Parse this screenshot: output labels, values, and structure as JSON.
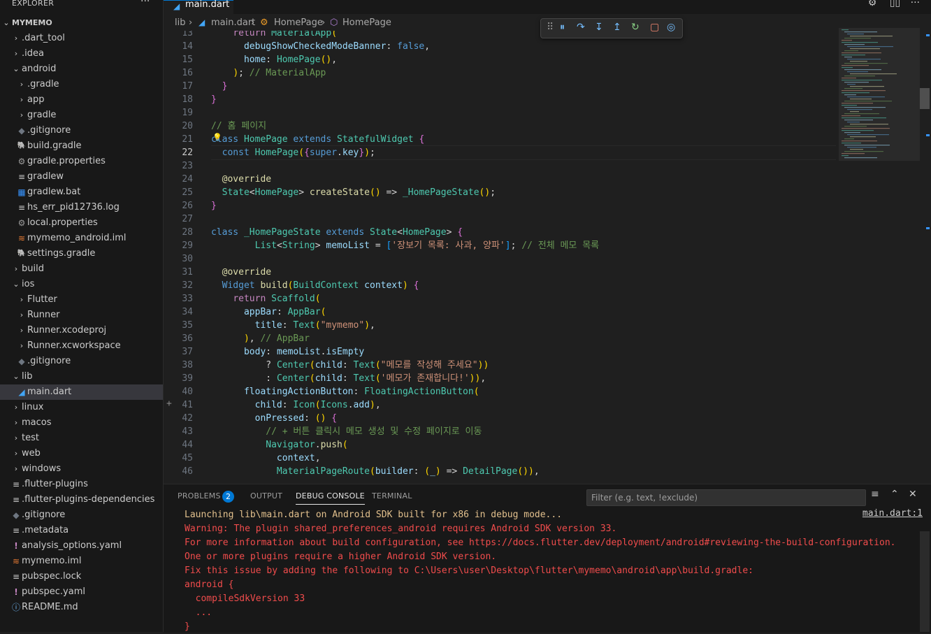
{
  "sidebar": {
    "explorer_title": "EXPLORER",
    "more_icon": "ellipsis-icon",
    "root": "MYMEMO",
    "items": [
      {
        "label": ".dart_tool",
        "kind": "folder",
        "depth": 1,
        "expanded": false
      },
      {
        "label": ".idea",
        "kind": "folder",
        "depth": 1,
        "expanded": false
      },
      {
        "label": "android",
        "kind": "folder",
        "depth": 1,
        "expanded": true
      },
      {
        "label": ".gradle",
        "kind": "folder",
        "depth": 2,
        "expanded": false
      },
      {
        "label": "app",
        "kind": "folder",
        "depth": 2,
        "expanded": false
      },
      {
        "label": "gradle",
        "kind": "folder",
        "depth": 2,
        "expanded": false
      },
      {
        "label": ".gitignore",
        "kind": "git",
        "depth": 2
      },
      {
        "label": "build.gradle",
        "kind": "gradle",
        "depth": 2
      },
      {
        "label": "gradle.properties",
        "kind": "gear",
        "depth": 2
      },
      {
        "label": "gradlew",
        "kind": "lines",
        "depth": 2
      },
      {
        "label": "gradlew.bat",
        "kind": "windows",
        "depth": 2
      },
      {
        "label": "hs_err_pid12736.log",
        "kind": "lines",
        "depth": 2
      },
      {
        "label": "local.properties",
        "kind": "gear",
        "depth": 2
      },
      {
        "label": "mymemo_android.iml",
        "kind": "rss",
        "depth": 2
      },
      {
        "label": "settings.gradle",
        "kind": "gradle",
        "depth": 2
      },
      {
        "label": "build",
        "kind": "folder",
        "depth": 1,
        "expanded": false
      },
      {
        "label": "ios",
        "kind": "folder",
        "depth": 1,
        "expanded": true
      },
      {
        "label": "Flutter",
        "kind": "folder",
        "depth": 2,
        "expanded": false
      },
      {
        "label": "Runner",
        "kind": "folder",
        "depth": 2,
        "expanded": false
      },
      {
        "label": "Runner.xcodeproj",
        "kind": "folder",
        "depth": 2,
        "expanded": false
      },
      {
        "label": "Runner.xcworkspace",
        "kind": "folder",
        "depth": 2,
        "expanded": false
      },
      {
        "label": ".gitignore",
        "kind": "git",
        "depth": 2
      },
      {
        "label": "lib",
        "kind": "folder",
        "depth": 1,
        "expanded": true
      },
      {
        "label": "main.dart",
        "kind": "dart",
        "depth": 2,
        "selected": true
      },
      {
        "label": "linux",
        "kind": "folder",
        "depth": 1,
        "expanded": false
      },
      {
        "label": "macos",
        "kind": "folder",
        "depth": 1,
        "expanded": false
      },
      {
        "label": "test",
        "kind": "folder",
        "depth": 1,
        "expanded": false
      },
      {
        "label": "web",
        "kind": "folder",
        "depth": 1,
        "expanded": false
      },
      {
        "label": "windows",
        "kind": "folder",
        "depth": 1,
        "expanded": false
      },
      {
        "label": ".flutter-plugins",
        "kind": "lines",
        "depth": 1
      },
      {
        "label": ".flutter-plugins-dependencies",
        "kind": "lines",
        "depth": 1
      },
      {
        "label": ".gitignore",
        "kind": "git",
        "depth": 1
      },
      {
        "label": ".metadata",
        "kind": "lines",
        "depth": 1
      },
      {
        "label": "analysis_options.yaml",
        "kind": "yaml",
        "depth": 1
      },
      {
        "label": "mymemo.iml",
        "kind": "rss",
        "depth": 1
      },
      {
        "label": "pubspec.lock",
        "kind": "lines",
        "depth": 1
      },
      {
        "label": "pubspec.yaml",
        "kind": "yaml",
        "depth": 1
      },
      {
        "label": "README.md",
        "kind": "info",
        "depth": 1
      }
    ]
  },
  "tab": {
    "label": "main.dart",
    "icon": "dart-icon"
  },
  "breadcrumb": [
    "lib",
    "main.dart",
    "HomePage",
    "HomePage"
  ],
  "debug_toolbar": [
    "drag-handle-icon",
    "pause-icon",
    "step-over-icon",
    "step-into-icon",
    "step-out-icon",
    "restart-icon",
    "stop-icon",
    "devtools-icon"
  ],
  "code": {
    "active_line": 22,
    "lines": [
      {
        "n": "13",
        "t": "    return MaterialApp("
      },
      {
        "n": "14",
        "t": "      debugShowCheckedModeBanner: false,"
      },
      {
        "n": "15",
        "t": "      home: HomePage(),"
      },
      {
        "n": "16",
        "t": "    ); // MaterialApp"
      },
      {
        "n": "17",
        "t": "  }"
      },
      {
        "n": "18",
        "t": "}"
      },
      {
        "n": "19",
        "t": ""
      },
      {
        "n": "20",
        "t": "// 홈 페이지"
      },
      {
        "n": "21",
        "t": "class HomePage extends StatefulWidget {"
      },
      {
        "n": "22",
        "t": "  const HomePage({super.key});"
      },
      {
        "n": "23",
        "t": ""
      },
      {
        "n": "24",
        "t": "  @override"
      },
      {
        "n": "25",
        "t": "  State<HomePage> createState() => _HomePageState();"
      },
      {
        "n": "26",
        "t": "}"
      },
      {
        "n": "27",
        "t": ""
      },
      {
        "n": "28",
        "t": "class _HomePageState extends State<HomePage> {"
      },
      {
        "n": "29",
        "t": "        List<String> memoList = ['장보기 목록: 사과, 양파']; // 전체 메모 목록"
      },
      {
        "n": "30",
        "t": ""
      },
      {
        "n": "31",
        "t": "  @override"
      },
      {
        "n": "32",
        "t": "  Widget build(BuildContext context) {"
      },
      {
        "n": "33",
        "t": "    return Scaffold("
      },
      {
        "n": "34",
        "t": "      appBar: AppBar("
      },
      {
        "n": "35",
        "t": "        title: Text(\"mymemo\"),"
      },
      {
        "n": "36",
        "t": "      ), // AppBar"
      },
      {
        "n": "37",
        "t": "      body: memoList.isEmpty"
      },
      {
        "n": "38",
        "t": "          ? Center(child: Text(\"메모를 작성해 주세요\"))"
      },
      {
        "n": "39",
        "t": "          : Center(child: Text('메모가 존재합니다!')),"
      },
      {
        "n": "40",
        "t": "      floatingActionButton: FloatingActionButton("
      },
      {
        "n": "41",
        "t": "        child: Icon(Icons.add),"
      },
      {
        "n": "42",
        "t": "        onPressed: () {"
      },
      {
        "n": "43",
        "t": "          // + 버튼 클릭시 메모 생성 및 수정 페이지로 이동"
      },
      {
        "n": "44",
        "t": "          Navigator.push("
      },
      {
        "n": "45",
        "t": "            context,"
      },
      {
        "n": "46",
        "t": "            MaterialPageRoute(builder: (_) => DetailPage()),"
      }
    ]
  },
  "panel": {
    "tabs": [
      {
        "label": "PROBLEMS",
        "badge": "2"
      },
      {
        "label": "OUTPUT"
      },
      {
        "label": "DEBUG CONSOLE",
        "active": true
      },
      {
        "label": "TERMINAL"
      }
    ],
    "filter_placeholder": "Filter (e.g. text, !exclude)",
    "link": "main.dart:1",
    "console": [
      {
        "text": "Launching lib\\main.dart on Android SDK built for x86 in debug mode...",
        "level": "info"
      },
      {
        "text": "Warning: The plugin shared_preferences_android requires Android SDK version 33.",
        "level": "error"
      },
      {
        "text": "For more information about build configuration, see https://docs.flutter.dev/deployment/android#reviewing-the-build-configuration.",
        "level": "error"
      },
      {
        "text": "One or more plugins require a higher Android SDK version.",
        "level": "error"
      },
      {
        "text": "Fix this issue by adding the following to C:\\Users\\user\\Desktop\\flutter\\mymemo\\android\\app\\build.gradle:",
        "level": "error"
      },
      {
        "text": "android {",
        "level": "error"
      },
      {
        "text": "  compileSdkVersion 33",
        "level": "error"
      },
      {
        "text": "  ...",
        "level": "error"
      },
      {
        "text": "}",
        "level": "error"
      }
    ]
  }
}
